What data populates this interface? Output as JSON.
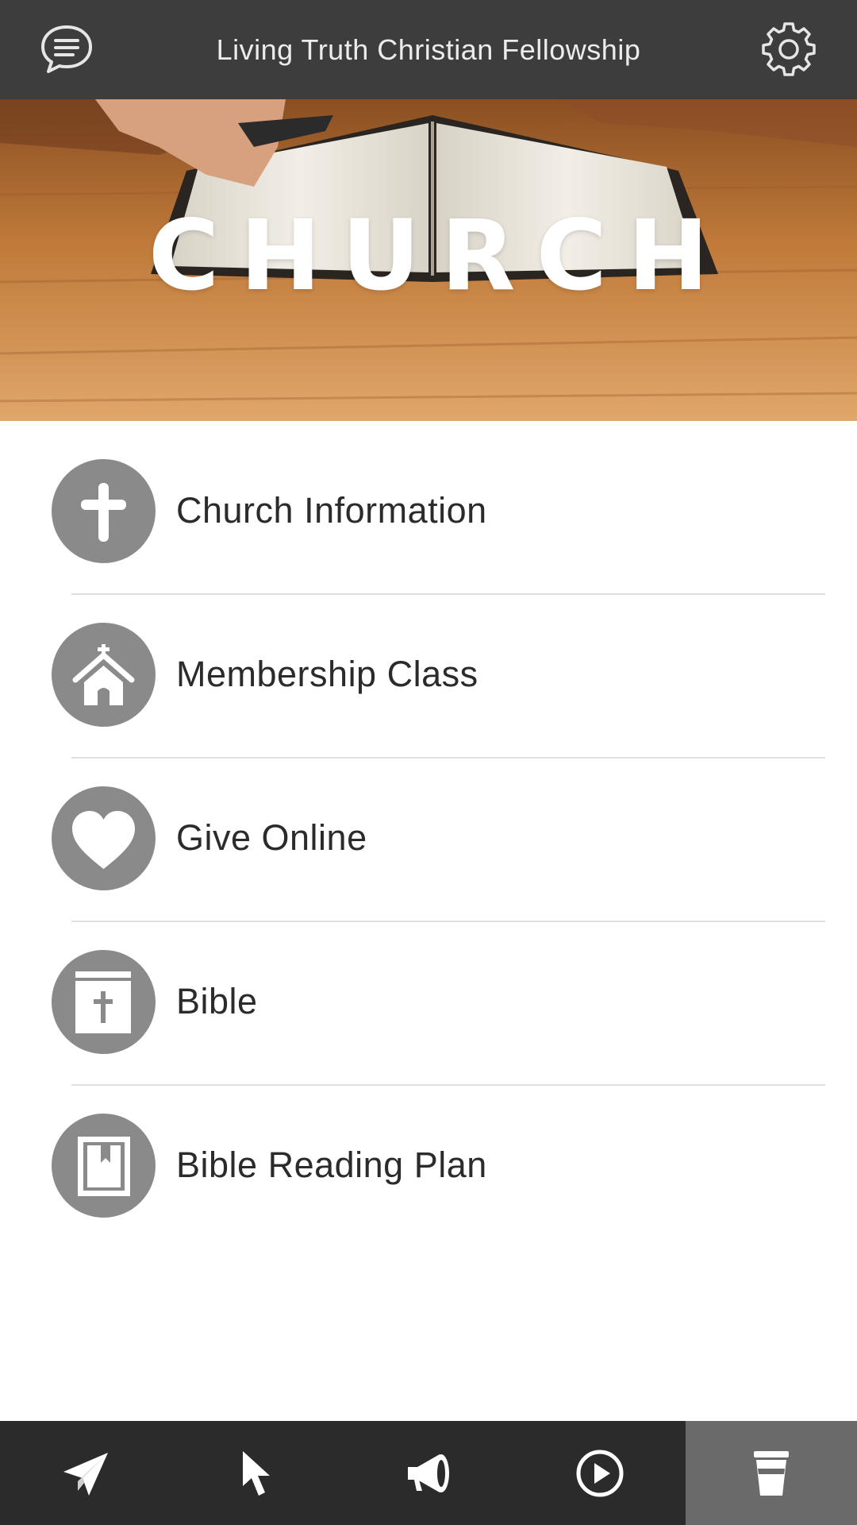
{
  "header": {
    "title": "Living Truth Christian Fellowship",
    "left_icon": "chat-bubble-icon",
    "right_icon": "gear-icon"
  },
  "banner": {
    "title": "CHURCH"
  },
  "menu": {
    "items": [
      {
        "label": "Church Information",
        "icon": "cross-icon"
      },
      {
        "label": "Membership Class",
        "icon": "chapel-icon"
      },
      {
        "label": "Give Online",
        "icon": "heart-icon"
      },
      {
        "label": "Bible",
        "icon": "bible-icon"
      },
      {
        "label": "Bible Reading Plan",
        "icon": "bookmark-book-icon"
      }
    ]
  },
  "bottom_nav": {
    "items": [
      {
        "icon": "paper-plane-icon"
      },
      {
        "icon": "pointer-icon"
      },
      {
        "icon": "megaphone-icon"
      },
      {
        "icon": "play-circle-icon"
      },
      {
        "icon": "cup-icon",
        "active": true
      }
    ]
  },
  "colors": {
    "header_bg": "#3d3d3d",
    "icon_circle": "#8a8a8a",
    "nav_bg": "#2b2b2b",
    "nav_active_bg": "#6a6a6a",
    "banner_wood": "#b9763a"
  }
}
